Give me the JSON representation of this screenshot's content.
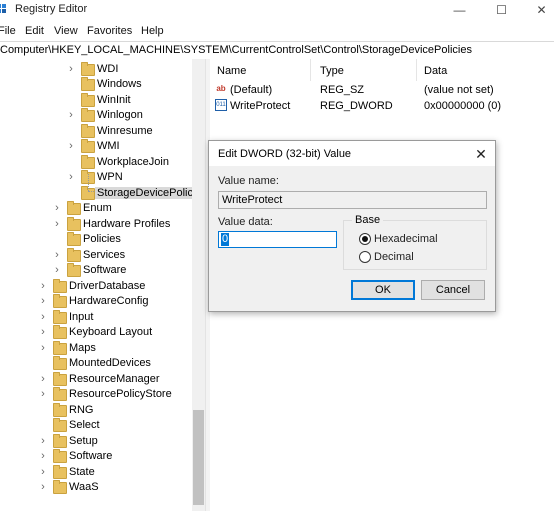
{
  "window": {
    "title": "Registry Editor",
    "controls": {
      "minimize": "—",
      "maximize": "☐",
      "close": "✕"
    }
  },
  "menu": [
    "File",
    "Edit",
    "View",
    "Favorites",
    "Help"
  ],
  "address": "Computer\\HKEY_LOCAL_MACHINE\\SYSTEM\\CurrentControlSet\\Control\\StorageDevicePolicies",
  "tree": {
    "level2": [
      {
        "label": "WDI",
        "expandable": true
      },
      {
        "label": "Windows",
        "expandable": false
      },
      {
        "label": "WinInit",
        "expandable": false
      },
      {
        "label": "Winlogon",
        "expandable": true
      },
      {
        "label": "Winresume",
        "expandable": false
      },
      {
        "label": "WMI",
        "expandable": true
      },
      {
        "label": "WorkplaceJoin",
        "expandable": false
      },
      {
        "label": "WPN",
        "expandable": true
      },
      {
        "label": "StorageDevicePolicie",
        "expandable": false,
        "selected": true
      }
    ],
    "level1": [
      {
        "label": "Enum",
        "expandable": true
      },
      {
        "label": "Hardware Profiles",
        "expandable": true
      },
      {
        "label": "Policies",
        "expandable": false
      },
      {
        "label": "Services",
        "expandable": true
      },
      {
        "label": "Software",
        "expandable": true
      }
    ],
    "level0": [
      {
        "label": "DriverDatabase",
        "expandable": true
      },
      {
        "label": "HardwareConfig",
        "expandable": true
      },
      {
        "label": "Input",
        "expandable": true
      },
      {
        "label": "Keyboard Layout",
        "expandable": true
      },
      {
        "label": "Maps",
        "expandable": true
      },
      {
        "label": "MountedDevices",
        "expandable": false
      },
      {
        "label": "ResourceManager",
        "expandable": true
      },
      {
        "label": "ResourcePolicyStore",
        "expandable": true
      },
      {
        "label": "RNG",
        "expandable": false
      },
      {
        "label": "Select",
        "expandable": false
      },
      {
        "label": "Setup",
        "expandable": true
      },
      {
        "label": "Software",
        "expandable": true
      },
      {
        "label": "State",
        "expandable": true
      },
      {
        "label": "WaaS",
        "expandable": true
      }
    ]
  },
  "list": {
    "headers": {
      "name": "Name",
      "type": "Type",
      "data": "Data"
    },
    "rows": [
      {
        "icon": "ab",
        "name": "(Default)",
        "type": "REG_SZ",
        "data": "(value not set)"
      },
      {
        "icon": "011",
        "name": "WriteProtect",
        "type": "REG_DWORD",
        "data": "0x00000000 (0)"
      }
    ]
  },
  "dialog": {
    "title": "Edit DWORD (32-bit) Value",
    "close": "✕",
    "value_name_label": "Value name:",
    "value_name": "WriteProtect",
    "value_data_label": "Value data:",
    "value_data": "0",
    "base_label": "Base",
    "base_options": [
      {
        "label": "Hexadecimal",
        "checked": true
      },
      {
        "label": "Decimal",
        "checked": false
      }
    ],
    "ok": "OK",
    "cancel": "Cancel"
  },
  "colors": {
    "accent": "#0078d7",
    "folder": "#e8c15f"
  }
}
